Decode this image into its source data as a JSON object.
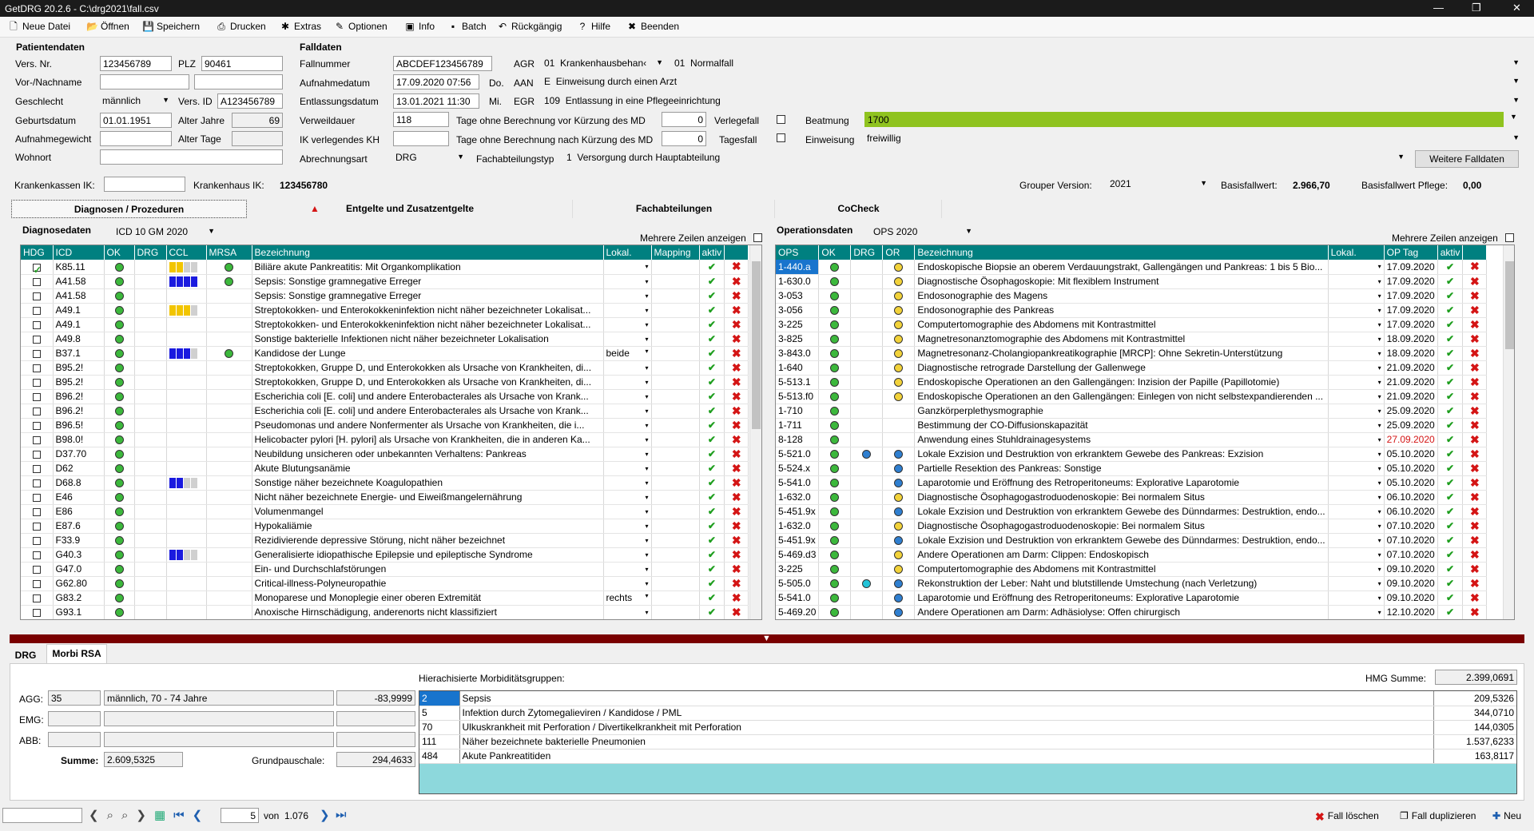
{
  "title": "GetDRG 20.2.6 - C:\\drg2021\\fall.csv",
  "menu": [
    {
      "label": "Neue Datei",
      "icon": "new-file-icon",
      "g": "🗋"
    },
    {
      "label": "Öffnen",
      "icon": "open-folder-icon",
      "g": "📂"
    },
    {
      "label": "Speichern",
      "icon": "save-icon",
      "g": "💾"
    },
    {
      "label": "Drucken",
      "icon": "print-icon",
      "g": "⎙"
    },
    {
      "label": "Extras",
      "icon": "extras-icon",
      "g": "✱"
    },
    {
      "label": "Optionen",
      "icon": "options-icon",
      "g": "✎"
    },
    {
      "label": "Info",
      "icon": "info-icon",
      "g": "▣"
    },
    {
      "label": "Batch",
      "icon": "batch-icon",
      "g": "▪"
    },
    {
      "label": "Rückgängig",
      "icon": "undo-icon",
      "g": "↶"
    },
    {
      "label": "Hilfe",
      "icon": "help-icon",
      "g": "?"
    },
    {
      "label": "Beenden",
      "icon": "exit-icon",
      "g": "✖"
    }
  ],
  "patient": {
    "header": "Patientendaten",
    "versnr_label": "Vers. Nr.",
    "versnr": "123456789",
    "plz_label": "PLZ",
    "plz": "90461",
    "name_label": "Vor-/Nachname",
    "gender_label": "Geschlecht",
    "gender": "männlich",
    "versid_label": "Vers. ID",
    "versid": "A123456789",
    "birth_label": "Geburtsdatum",
    "birth": "01.01.1951",
    "age_label": "Alter Jahre",
    "age": "69",
    "weight_label": "Aufnahmegewicht",
    "agedays_label": "Alter Tage",
    "residence_label": "Wohnort"
  },
  "case": {
    "header": "Falldaten",
    "nr_label": "Fallnummer",
    "nr": "ABCDEF123456789",
    "agr_label": "AGR",
    "agr_code": "01",
    "agr_text": "Krankenhausbehan‹",
    "agr2_code": "01",
    "agr2_text": "Normalfall",
    "adm_label": "Aufnahmedatum",
    "adm": "17.09.2020 07:56",
    "adm_day": "Do.",
    "aan_label": "AAN",
    "aan_code": "E",
    "aan_text": "Einweisung durch einen Arzt",
    "dis_label": "Entlassungsdatum",
    "dis": "13.01.2021 11:30",
    "dis_day": "Mi.",
    "egr_label": "EGR",
    "egr_code": "109",
    "egr_text": "Entlassung in eine Pflegeeinrichtung",
    "los_label": "Verweildauer",
    "los": "118",
    "before_label": "Tage ohne Berechnung vor Kürzung des MD",
    "before": "0",
    "transfer_label": "Verlegefall",
    "vent_label": "Beatmung",
    "vent": "1700",
    "ik_label": "IK verlegendes KH",
    "after_label": "Tage ohne Berechnung nach Kürzung des MD",
    "after": "0",
    "day_label": "Tagesfall",
    "referral_label": "Einweisung",
    "referral": "freiwillig",
    "billing_label": "Abrechnungsart",
    "billing": "DRG",
    "dept_label": "Fachabteilungstyp",
    "dept_code": "1",
    "dept_text": "Versorgung durch Hauptabteilung",
    "more_btn": "Weitere Falldaten"
  },
  "ik": {
    "kasse_label": "Krankenkassen IK:",
    "kh_label": "Krankenhaus IK:",
    "kh": "123456780",
    "grouper_label": "Grouper Version:",
    "grouper": "2021",
    "base_label": "Basisfallwert:",
    "base": "2.966,70",
    "care_label": "Basisfallwert Pflege:",
    "care": "0,00"
  },
  "tabs": [
    "Diagnosen / Prozeduren",
    "Entgelte und Zusatzentgelte",
    "Fachabteilungen",
    "CoCheck"
  ],
  "diag": {
    "header": "Diagnosedaten",
    "catalog": "ICD 10 GM 2020",
    "multi": "Mehrere Zeilen anzeigen",
    "cols": [
      "HDG",
      "ICD",
      "OK",
      "DRG",
      "CCL",
      "MRSA",
      "Bezeichnung",
      "Lokal.",
      "Mapping",
      "aktiv"
    ],
    "rows": [
      [
        "K85.11",
        "Biliäre akute Pankreatitis: Mit Organkomplikation",
        "",
        "yy2",
        1,
        1
      ],
      [
        "A41.58",
        "Sepsis: Sonstige gramnegative Erreger",
        "",
        "bbbb",
        1,
        0
      ],
      [
        "A41.58",
        "Sepsis: Sonstige gramnegative Erreger",
        "",
        "",
        0,
        0
      ],
      [
        "A49.1",
        "Streptokokken- und Enterokokkeninfektion nicht näher bezeichneter Lokalisat...",
        "",
        "yyy1",
        0,
        0
      ],
      [
        "A49.1",
        "Streptokokken- und Enterokokkeninfektion nicht näher bezeichneter Lokalisat...",
        "",
        "",
        0,
        0
      ],
      [
        "A49.8",
        "Sonstige bakterielle Infektionen nicht näher bezeichneter Lokalisation",
        "",
        "",
        0,
        0
      ],
      [
        "B37.1",
        "Kandidose der Lunge",
        "beide",
        "bbb1",
        1,
        0
      ],
      [
        "B95.2!",
        "Streptokokken, Gruppe D, und Enterokokken als Ursache von Krankheiten, di...",
        "",
        "",
        0,
        0
      ],
      [
        "B95.2!",
        "Streptokokken, Gruppe D, und Enterokokken als Ursache von Krankheiten, di...",
        "",
        "",
        0,
        0
      ],
      [
        "B96.2!",
        "Escherichia coli [E. coli] und andere Enterobacterales als Ursache von Krank...",
        "",
        "",
        0,
        0
      ],
      [
        "B96.2!",
        "Escherichia coli [E. coli] und andere Enterobacterales als Ursache von Krank...",
        "",
        "",
        0,
        0
      ],
      [
        "B96.5!",
        "Pseudomonas und andere Nonfermenter als Ursache von Krankheiten, die i...",
        "",
        "",
        0,
        0
      ],
      [
        "B98.0!",
        "Helicobacter pylori [H. pylori] als Ursache von Krankheiten, die in anderen Ka...",
        "",
        "",
        0,
        0
      ],
      [
        "D37.70",
        "Neubildung unsicheren oder unbekannten Verhaltens: Pankreas",
        "",
        "",
        0,
        0
      ],
      [
        "D62",
        "Akute Blutungsanämie",
        "",
        "",
        0,
        0
      ],
      [
        "D68.8",
        "Sonstige näher bezeichnete Koagulopathien",
        "",
        "bb2",
        0,
        0
      ],
      [
        "E46",
        "Nicht näher bezeichnete Energie- und Eiweißmangelernährung",
        "",
        "",
        0,
        0
      ],
      [
        "E86",
        "Volumenmangel",
        "",
        "",
        0,
        0
      ],
      [
        "E87.6",
        "Hypokaliämie",
        "",
        "",
        0,
        0
      ],
      [
        "F33.9",
        "Rezidivierende depressive Störung, nicht näher bezeichnet",
        "",
        "",
        0,
        0
      ],
      [
        "G40.3",
        "Generalisierte idiopathische Epilepsie und epileptische Syndrome",
        "",
        "bb2",
        0,
        0
      ],
      [
        "G47.0",
        "Ein- und Durchschlafstörungen",
        "",
        "",
        0,
        0
      ],
      [
        "G62.80",
        "Critical-illness-Polyneuropathie",
        "",
        "",
        0,
        0
      ],
      [
        "G83.2",
        "Monoparese und Monoplegie einer oberen Extremität",
        "rechts",
        "",
        0,
        0
      ],
      [
        "G93.1",
        "Anoxische Hirnschädigung, anderenorts nicht klassifiziert",
        "",
        "",
        0,
        0
      ]
    ]
  },
  "ops": {
    "header": "Operationsdaten",
    "catalog": "OPS 2020",
    "multi": "Mehrere Zeilen anzeigen",
    "cols": [
      "OPS",
      "OK",
      "DRG",
      "OR",
      "Bezeichnung",
      "Lokal.",
      "OP Tag",
      "aktiv"
    ],
    "rows": [
      [
        "1-440.a",
        "",
        "y",
        "Endoskopische Biopsie an oberem Verdauungstrakt, Gallengängen und Pankreas: 1 bis 5 Bio...",
        "17.09.2020",
        0
      ],
      [
        "1-630.0",
        "",
        "y",
        "Diagnostische Ösophagoskopie: Mit flexiblem Instrument",
        "17.09.2020",
        0
      ],
      [
        "3-053",
        "",
        "y",
        "Endosonographie des Magens",
        "17.09.2020",
        0
      ],
      [
        "3-056",
        "",
        "y",
        "Endosonographie des Pankreas",
        "17.09.2020",
        0
      ],
      [
        "3-225",
        "",
        "y",
        "Computertomographie des Abdomens mit Kontrastmittel",
        "17.09.2020",
        0
      ],
      [
        "3-825",
        "",
        "y",
        "Magnetresonanztomographie des Abdomens mit Kontrastmittel",
        "18.09.2020",
        0
      ],
      [
        "3-843.0",
        "",
        "y",
        "Magnetresonanz-Cholangiopankreatikographie [MRCP]: Ohne Sekretin-Unterstützung",
        "18.09.2020",
        0
      ],
      [
        "1-640",
        "",
        "y",
        "Diagnostische retrograde Darstellung der Gallenwege",
        "21.09.2020",
        0
      ],
      [
        "5-513.1",
        "",
        "y",
        "Endoskopische Operationen an den Gallengängen: Inzision der Papille (Papillotomie)",
        "21.09.2020",
        0
      ],
      [
        "5-513.f0",
        "",
        "y",
        "Endoskopische Operationen an den Gallengängen: Einlegen von nicht selbstexpandierenden ...",
        "21.09.2020",
        0
      ],
      [
        "1-710",
        "",
        "",
        "Ganzkörperplethysmographie",
        "25.09.2020",
        0
      ],
      [
        "1-711",
        "",
        "",
        "Bestimmung der CO-Diffusionskapazität",
        "25.09.2020",
        0
      ],
      [
        "8-128",
        "",
        "",
        "Anwendung eines Stuhldrainagesystems",
        "27.09.2020",
        1
      ],
      [
        "5-521.0",
        "b",
        "b",
        "Lokale Exzision und Destruktion von erkranktem Gewebe des Pankreas: Exzision",
        "05.10.2020",
        0
      ],
      [
        "5-524.x",
        "",
        "b",
        "Partielle Resektion des Pankreas: Sonstige",
        "05.10.2020",
        0
      ],
      [
        "5-541.0",
        "",
        "b",
        "Laparotomie und Eröffnung des Retroperitoneums: Explorative Laparotomie",
        "05.10.2020",
        0
      ],
      [
        "1-632.0",
        "",
        "y",
        "Diagnostische Ösophagogastroduodenoskopie: Bei normalem Situs",
        "06.10.2020",
        0
      ],
      [
        "5-451.9x",
        "",
        "b",
        "Lokale Exzision und Destruktion von erkranktem Gewebe des Dünndarmes: Destruktion, endo...",
        "06.10.2020",
        0
      ],
      [
        "1-632.0",
        "",
        "y",
        "Diagnostische Ösophagogastroduodenoskopie: Bei normalem Situs",
        "07.10.2020",
        0
      ],
      [
        "5-451.9x",
        "",
        "b",
        "Lokale Exzision und Destruktion von erkranktem Gewebe des Dünndarmes: Destruktion, endo...",
        "07.10.2020",
        0
      ],
      [
        "5-469.d3",
        "",
        "y",
        "Andere Operationen am Darm: Clippen: Endoskopisch",
        "07.10.2020",
        0
      ],
      [
        "3-225",
        "",
        "y",
        "Computertomographie des Abdomens mit Kontrastmittel",
        "09.10.2020",
        0
      ],
      [
        "5-505.0",
        "c",
        "b",
        "Rekonstruktion der Leber: Naht und blutstillende Umstechung (nach Verletzung)",
        "09.10.2020",
        0
      ],
      [
        "5-541.0",
        "",
        "b",
        "Laparotomie und Eröffnung des Retroperitoneums: Explorative Laparotomie",
        "09.10.2020",
        0
      ],
      [
        "5-469.20",
        "",
        "b",
        "Andere Operationen am Darm: Adhäsiolyse: Offen chirurgisch",
        "12.10.2020",
        0
      ]
    ]
  },
  "bottom_tabs": [
    "DRG",
    "Morbi RSA"
  ],
  "morbi": {
    "agg_label": "AGG:",
    "agg_code": "35",
    "agg_text": "männlich, 70 - 74 Jahre",
    "agg_val": "-83,9999",
    "emg_label": "EMG:",
    "abb_label": "ABB:",
    "sum_label": "Summe:",
    "sum": "2.609,5325",
    "base_label": "Grundpauschale:",
    "base": "294,4633",
    "hmg_header": "Hierachisierte Morbiditätsgruppen:",
    "hmg_sum_label": "HMG Summe:",
    "hmg_sum": "2.399,0691",
    "rows": [
      [
        "2",
        "Sepsis",
        "209,5326"
      ],
      [
        "5",
        "Infektion durch Zytomegalieviren / Kandidose / PML",
        "344,0710"
      ],
      [
        "70",
        "Ulkuskrankheit mit Perforation / Divertikelkrankheit mit Perforation",
        "144,0305"
      ],
      [
        "111",
        "Näher bezeichnete bakterielle Pneumonien",
        "1.537,6233"
      ],
      [
        "484",
        "Akute Pankreatitiden",
        "163,8117"
      ]
    ]
  },
  "nav": {
    "page": "5",
    "of_label": "von",
    "total": "1.076",
    "delete": "Fall löschen",
    "duplicate": "Fall duplizieren",
    "new": "Neu"
  },
  "colors": {
    "teal": "#008080",
    "green": "#8fc31f",
    "accent": "#7a0000"
  }
}
